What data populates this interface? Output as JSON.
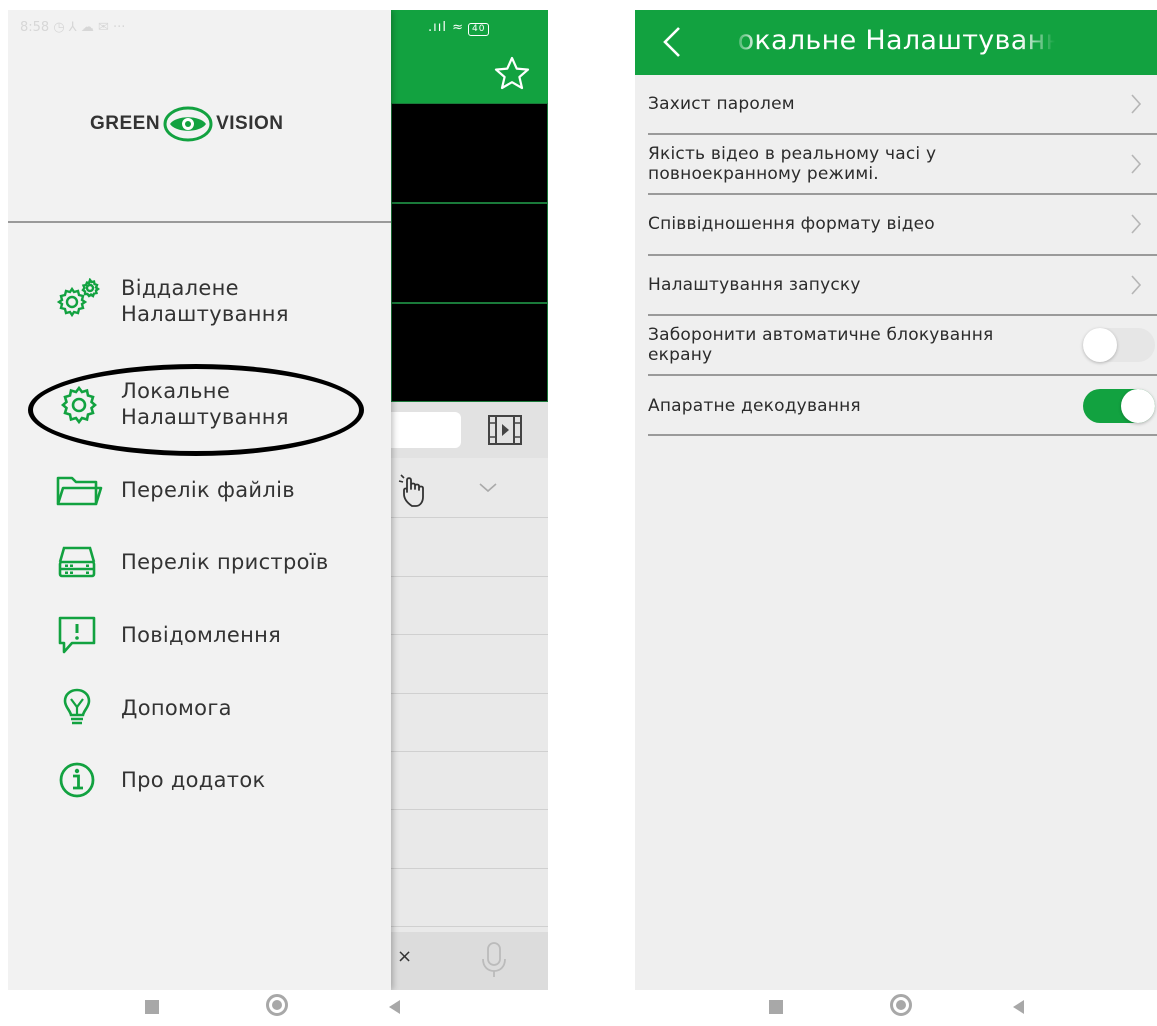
{
  "colors": {
    "brand_green": "#12a240",
    "header_text": "#ffffff"
  },
  "left_phone": {
    "status_bar": {
      "time_left": "8:58 ◷ ⅄ ☁ ✉ ···",
      "right_indicators": ".ııl ≈",
      "battery": "40"
    },
    "logo": {
      "text_left": "GREEN",
      "text_right": "VISION"
    },
    "drawer_menu": [
      {
        "label": "Віддалене\nНалаштування",
        "icon": "gears-icon"
      },
      {
        "label": "Локальне\nНалаштування",
        "icon": "gear-icon",
        "highlighted": true
      },
      {
        "label": "Перелік файлів",
        "icon": "folder-icon"
      },
      {
        "label": "Перелік пристроїв",
        "icon": "device-icon"
      },
      {
        "label": "Повідомлення",
        "icon": "message-alert-icon"
      },
      {
        "label": "Допомога",
        "icon": "lightbulb-icon"
      },
      {
        "label": "Про додаток",
        "icon": "info-icon"
      }
    ],
    "background_app": {
      "close_symbol": "×"
    }
  },
  "right_phone": {
    "header": {
      "back_icon": "chevron-left-icon",
      "title": "Локальне Налаштування"
    },
    "settings": [
      {
        "label": "Захист паролем",
        "control": "chevron"
      },
      {
        "label": "Якість відео в реальному часі у\nповноекранному режимі.",
        "control": "chevron"
      },
      {
        "label": "Співвідношення формату відео",
        "control": "chevron"
      },
      {
        "label": "Налаштування запуску",
        "control": "chevron"
      },
      {
        "label": "Заборонити автоматичне блокування\nекрану",
        "control": "toggle",
        "enabled": false
      },
      {
        "label": "Апаратне декодування",
        "control": "toggle",
        "enabled": true
      }
    ]
  },
  "nav_bar": {
    "buttons": [
      "recents",
      "home",
      "back"
    ]
  }
}
